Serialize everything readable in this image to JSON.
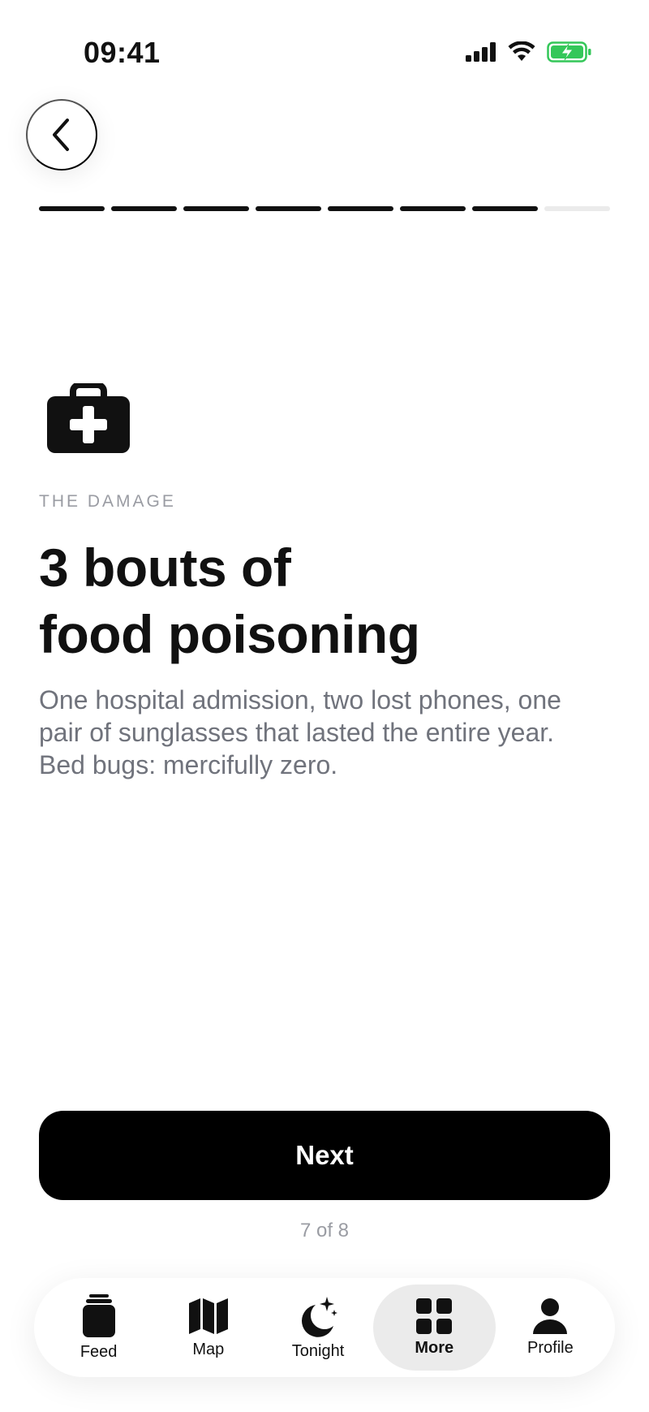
{
  "status_bar": {
    "time": "09:41"
  },
  "progress": {
    "current": 7,
    "total": 8
  },
  "story": {
    "eyebrow": "THE DAMAGE",
    "headline_line1": "3 bouts of",
    "headline_line2": "food poisoning",
    "body_line1": "One hospital admission, two lost phones, one",
    "body_line2": "pair of sunglasses that lasted the entire year.",
    "body_line3": "Bed bugs: mercifully zero.",
    "icon": "medical-kit-icon"
  },
  "next_button": {
    "label": "Next"
  },
  "counter": "7 of 8",
  "tab_bar": {
    "tabs": [
      {
        "label": "Feed",
        "icon": "feed-icon"
      },
      {
        "label": "Map",
        "icon": "map-icon"
      },
      {
        "label": "Tonight",
        "icon": "moon-stars-icon"
      },
      {
        "label": "More",
        "icon": "grid-icon",
        "active": true
      },
      {
        "label": "Profile",
        "icon": "person-icon"
      }
    ]
  },
  "colors": {
    "accent": "#000000",
    "muted": "#70737c",
    "battery": "#34c759"
  }
}
